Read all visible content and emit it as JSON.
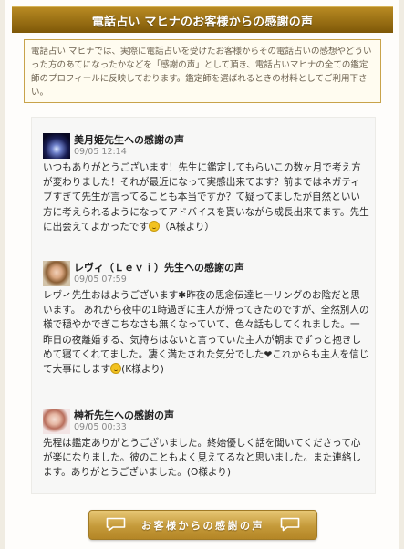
{
  "header": {
    "title": "電話占い マヒナのお客様からの感謝の声"
  },
  "intro": {
    "text": "電話占い マヒナでは、実際に電話占いを受けたお客様からその電話占いの感想やどういった方のあてになったかなどを「感謝の声」として頂き、電話占いマヒナの全ての鑑定師のプロフィールに反映しております。鑑定師を選ばれるときの材料としてご利用下さい。"
  },
  "entries": [
    {
      "title": "美月姫先生への感謝の声",
      "date": "09/05 12:14",
      "body": "いつもありがとうございます！先生に鑑定してもらいこの数ヶ月で考え方が変わりました！それが最近になって実感出来てます？前まではネガティブすぎて先生が言ってることも本当ですか？て疑ってましたが自然といい方に考えられるようになってアドバイスを貰いながら成長出来てます。先生に出会えてよかったです",
      "tail": "（A様より）"
    },
    {
      "title": "レヴィ（Ｌｅｖｉ）先生への感謝の声",
      "date": "09/05 07:59",
      "body": "レヴィ先生おはようございます✱昨夜の思念伝達ヒーリングのお陰だと思います。 あれから夜中の1時過ぎに主人が帰ってきたのですが、全然別人の様で穏やかでぎこちなさも無くなっていて、色々話もしてくれました。一昨日の夜離婚する、気持ちはないと言っていた主人が朝までずっと抱きしめて寝てくれてました。凄く満たされた気分でした❤これからも主人を信じて大事にします",
      "tail": "(K様より)"
    },
    {
      "title": "榊祈先生への感謝の声",
      "date": "09/05 00:33",
      "body": "先程は鑑定ありがとうございました。終始優しく話を聞いてくださって心が楽になりました。彼のこともよく見えてるなと思いました。また連絡します。ありがとうございました。(O様より)",
      "tail": ""
    }
  ],
  "button": {
    "label": "お客様からの感謝の声"
  },
  "icons": {
    "thumb1": "avatar-image",
    "thumb2": "avatar-image",
    "thumb3": "avatar-image",
    "emoji": "smiley-emoji-icon",
    "button_icon": "speech-bubble-icon"
  },
  "colors": {
    "header_gold": "#9a6f14",
    "intro_border": "#c8a34a",
    "button_gold": "#c59a3a"
  }
}
